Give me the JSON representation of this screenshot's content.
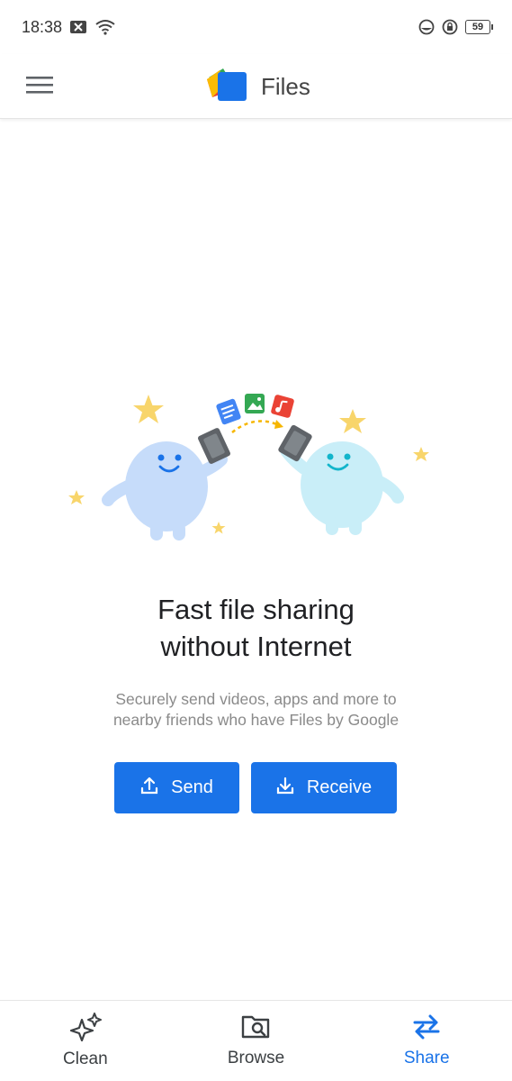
{
  "status_bar": {
    "time": "18:38",
    "battery_level": "59",
    "icons": [
      "close-notification-icon",
      "wifi-icon",
      "do-not-disturb-icon",
      "rotation-lock-icon",
      "battery-icon"
    ]
  },
  "app_bar": {
    "title": "Files",
    "menu_icon": "hamburger-menu-icon",
    "logo_icon": "files-by-google-logo"
  },
  "main": {
    "headline_line1": "Fast file sharing",
    "headline_line2": "without Internet",
    "subtext_line1": "Securely send videos, apps and more to",
    "subtext_line2": "nearby friends who have Files by Google",
    "send_button": {
      "label": "Send",
      "icon": "upload-icon"
    },
    "receive_button": {
      "label": "Receive",
      "icon": "download-icon"
    }
  },
  "bottom_nav": {
    "items": [
      {
        "label": "Clean",
        "icon": "sparkle-icon",
        "active": false
      },
      {
        "label": "Browse",
        "icon": "folder-search-icon",
        "active": false
      },
      {
        "label": "Share",
        "icon": "swap-arrows-icon",
        "active": true
      }
    ]
  },
  "colors": {
    "accent": "#1a73e8",
    "button_text": "#ffffff",
    "subtext": "#8a8a8a"
  }
}
